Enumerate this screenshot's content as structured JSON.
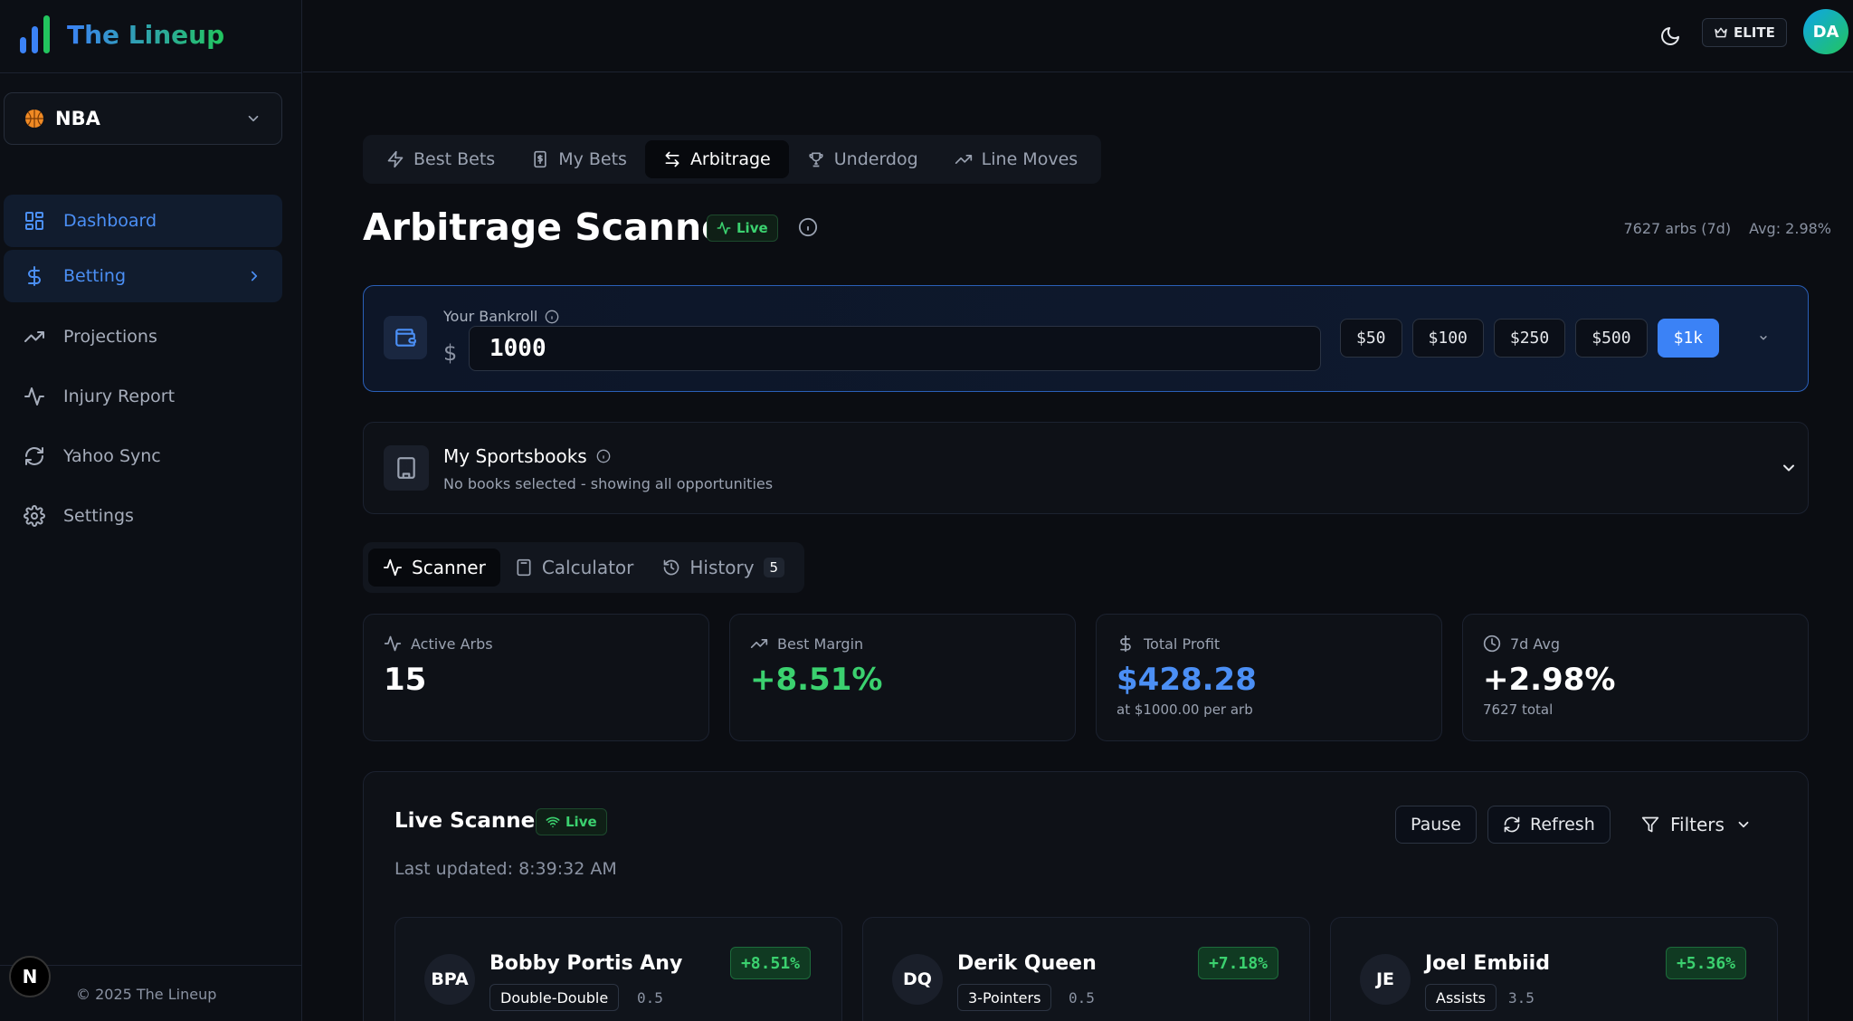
{
  "app": {
    "name": "The Lineup",
    "league": "NBA",
    "copyright": "© 2025 The Lineup",
    "n_badge": "N"
  },
  "sidebar": {
    "items": [
      {
        "label": "Dashboard",
        "icon": "dashboard-icon",
        "active": true
      },
      {
        "label": "Betting",
        "icon": "dollar-icon",
        "active": true
      },
      {
        "label": "Projections",
        "icon": "trending-icon"
      },
      {
        "label": "Injury Report",
        "icon": "pulse-icon"
      },
      {
        "label": "Yahoo Sync",
        "icon": "sync-icon"
      },
      {
        "label": "Settings",
        "icon": "gear-icon"
      }
    ]
  },
  "topbar": {
    "tier": "ELITE",
    "avatar_initials": "DA"
  },
  "tabs": [
    {
      "label": "Best Bets"
    },
    {
      "label": "My Bets"
    },
    {
      "label": "Arbitrage",
      "active": true
    },
    {
      "label": "Underdog"
    },
    {
      "label": "Line Moves"
    }
  ],
  "page": {
    "title": "Arbitrage Scanner",
    "live": "Live",
    "arbs_7d": "7627 arbs (7d)",
    "avg": "Avg: 2.98%"
  },
  "bankroll": {
    "label": "Your Bankroll",
    "currency": "$",
    "value": "1000",
    "presets": [
      "$50",
      "$100",
      "$250",
      "$500",
      "$1k"
    ],
    "active_preset": "$1k"
  },
  "sportsbooks": {
    "title": "My Sportsbooks",
    "subtitle": "No books selected - showing all opportunities"
  },
  "subtabs": {
    "scanner": "Scanner",
    "calculator": "Calculator",
    "history": "History",
    "history_count": "5"
  },
  "stats": [
    {
      "label": "Active Arbs",
      "value": "15",
      "sub": "",
      "color": "#ffffff"
    },
    {
      "label": "Best Margin",
      "value": "+8.51%",
      "sub": "",
      "color": "#3bd16f"
    },
    {
      "label": "Total Profit",
      "value": "$428.28",
      "sub": "at $1000.00 per arb",
      "color": "#4b8ff5"
    },
    {
      "label": "7d Avg",
      "value": "+2.98%",
      "sub": "7627 total",
      "color": "#ffffff"
    }
  ],
  "scanner": {
    "title": "Live Scanner",
    "live": "Live",
    "last_updated": "Last updated: 8:39:32 AM",
    "pause": "Pause",
    "refresh": "Refresh",
    "filters": "Filters",
    "arbs": [
      {
        "initials": "BPA",
        "name": "Bobby Portis Any",
        "market": "Double-Double",
        "line": "0.5",
        "margin": "+8.51%"
      },
      {
        "initials": "DQ",
        "name": "Derik Queen",
        "market": "3-Pointers",
        "line": "0.5",
        "margin": "+7.18%"
      },
      {
        "initials": "JE",
        "name": "Joel Embiid",
        "market": "Assists",
        "line": "3.5",
        "margin": "+5.36%"
      }
    ]
  },
  "colors": {
    "accent": "#3b82f6",
    "positive": "#3bd16f",
    "background": "#0b0d12"
  }
}
